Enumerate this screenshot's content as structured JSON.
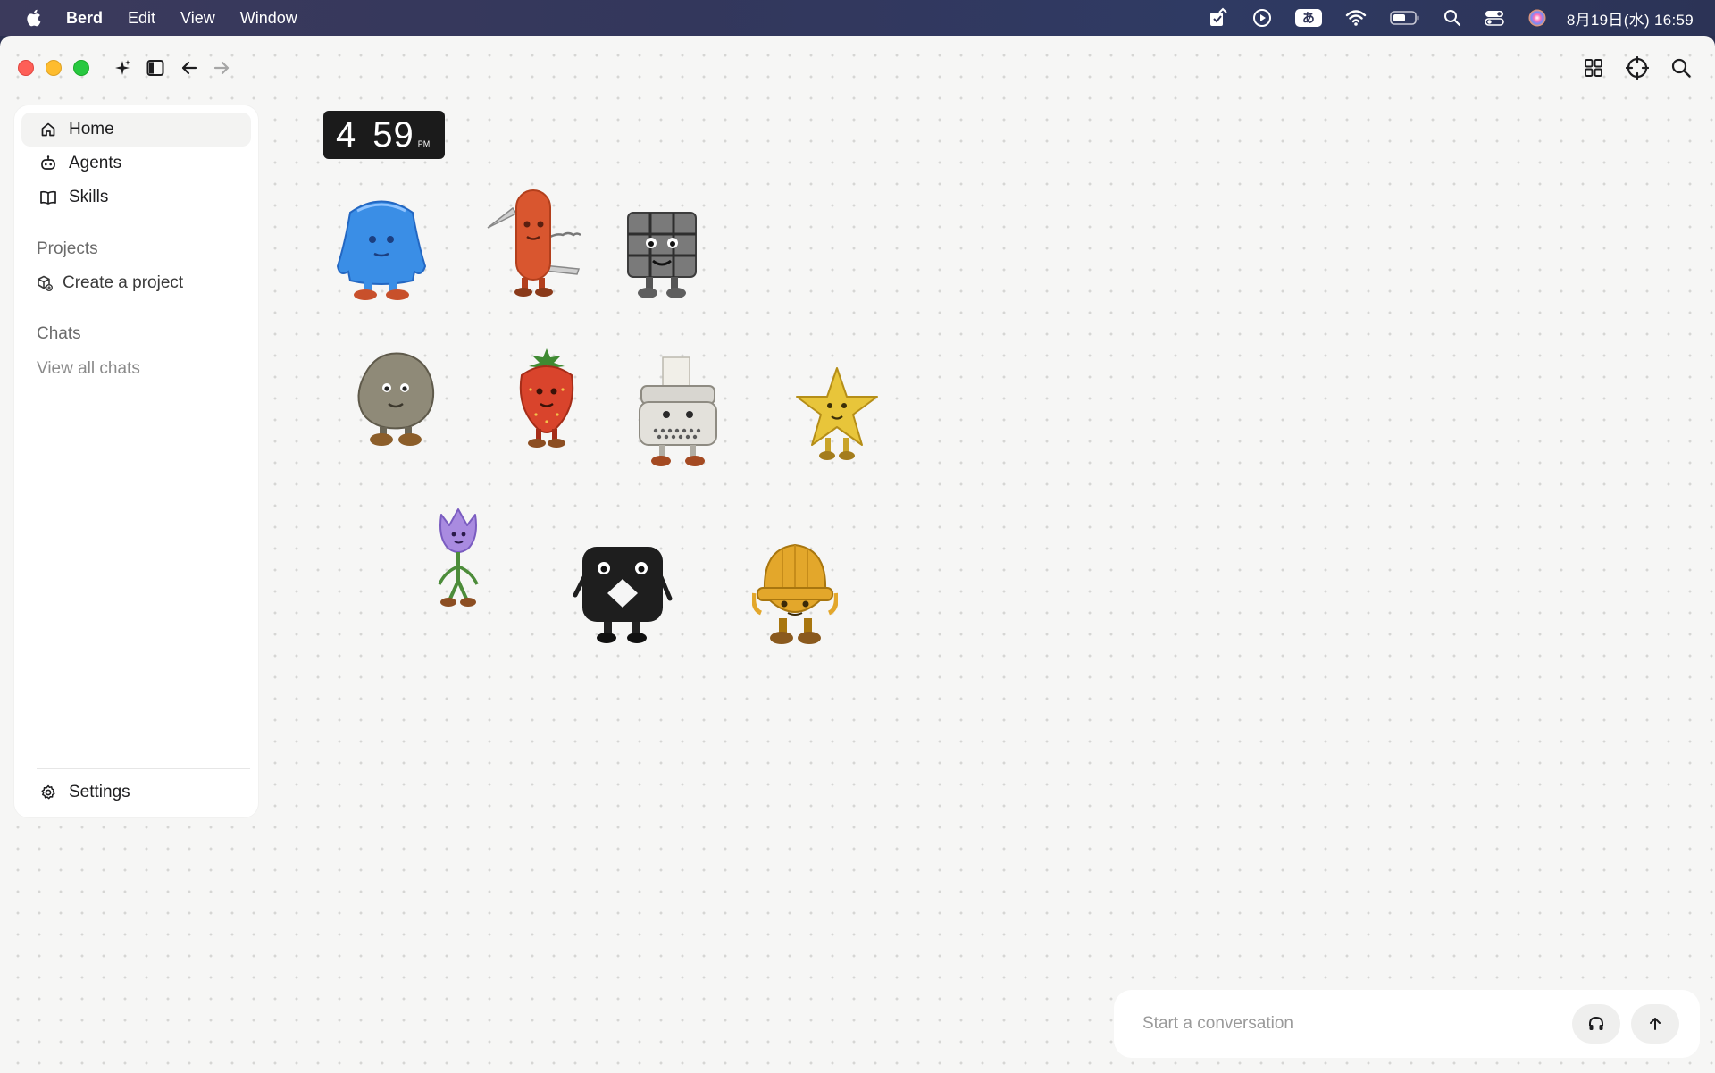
{
  "menubar": {
    "app_name": "Berd",
    "menus": [
      "Edit",
      "View",
      "Window"
    ],
    "ime_label": "あ",
    "datetime": "8月19日(水) 16:59"
  },
  "sidebar": {
    "nav": [
      {
        "label": "Home",
        "icon": "home-icon",
        "active": true
      },
      {
        "label": "Agents",
        "icon": "robot-icon",
        "active": false
      },
      {
        "label": "Skills",
        "icon": "book-icon",
        "active": false
      }
    ],
    "projects_title": "Projects",
    "create_project": "Create a project",
    "chats_title": "Chats",
    "view_all_chats": "View all chats",
    "settings": "Settings"
  },
  "clock_widget": {
    "hour": "4",
    "minute": "59",
    "period": "PM"
  },
  "characters": [
    {
      "name": "blue-jelly-character",
      "color": "#3a8ee6"
    },
    {
      "name": "swiss-knife-character",
      "color": "#d9562f"
    },
    {
      "name": "rubiks-cube-character",
      "color": "#7a7a7a"
    },
    {
      "name": "rock-character",
      "color": "#8f8a78"
    },
    {
      "name": "strawberry-character",
      "color": "#d9442c"
    },
    {
      "name": "typewriter-character",
      "color": "#d8d6d0"
    },
    {
      "name": "star-character",
      "color": "#e8c53a"
    },
    {
      "name": "tulip-character",
      "color": "#a98be0"
    },
    {
      "name": "black-cube-character",
      "color": "#1e1e1e"
    },
    {
      "name": "hard-hat-character",
      "color": "#e3a72b"
    }
  ],
  "composer": {
    "placeholder": "Start a conversation"
  }
}
